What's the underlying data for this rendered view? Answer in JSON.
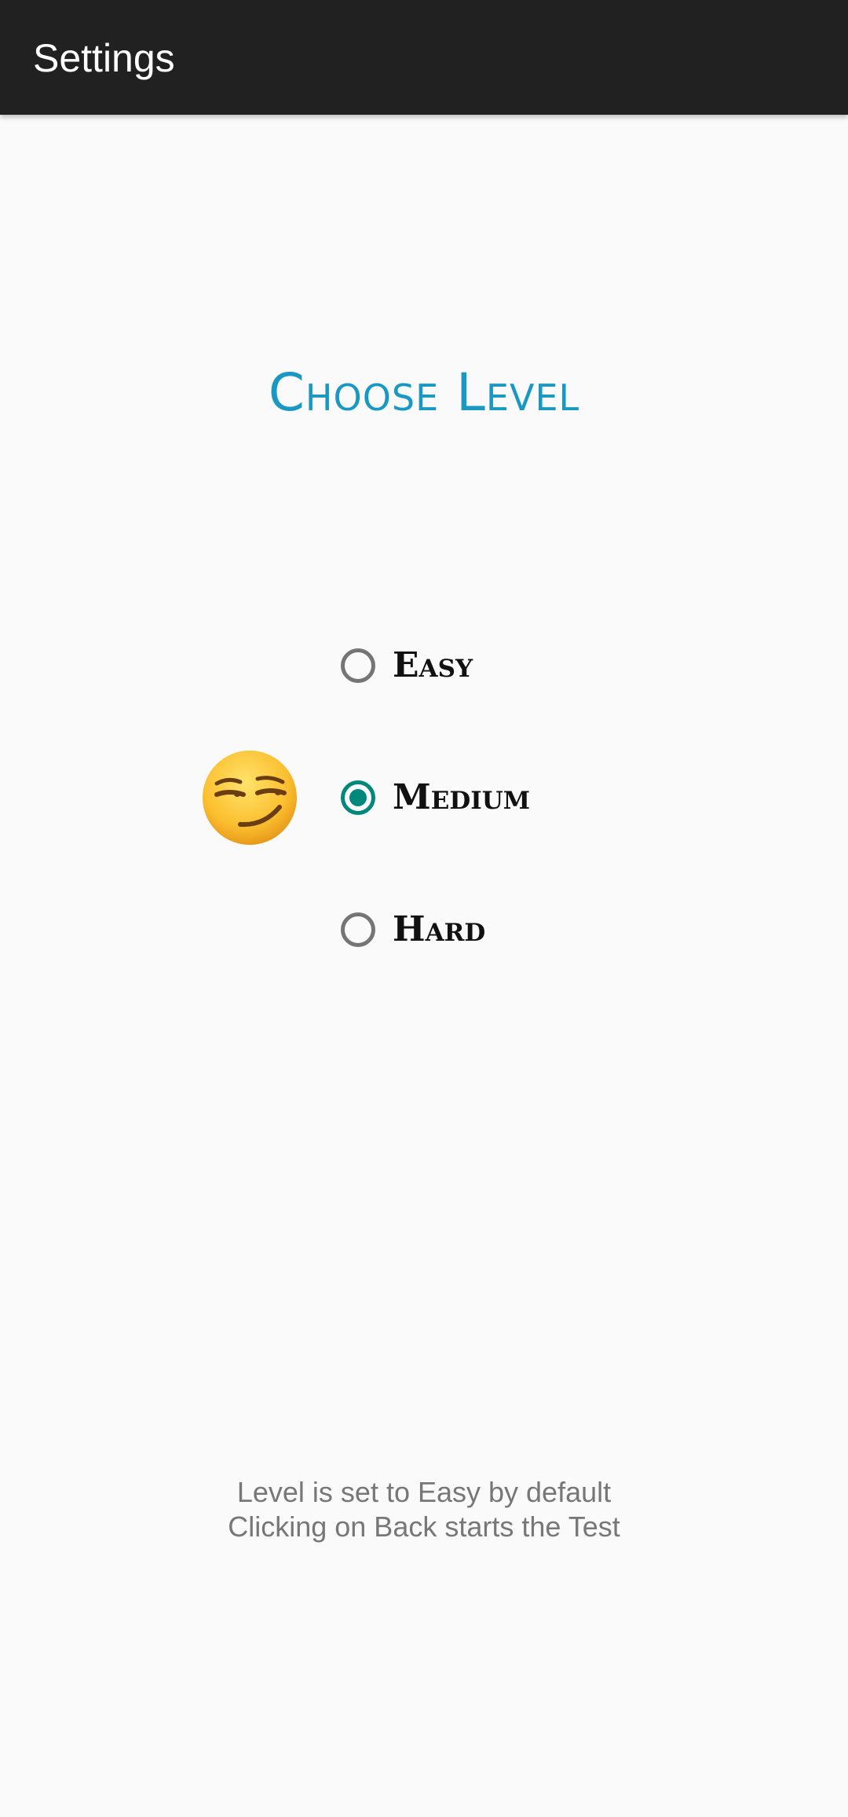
{
  "app_bar": {
    "title": "Settings"
  },
  "main": {
    "heading": "Choose Level",
    "mood_icon": "smirking-face-emoji",
    "options": [
      {
        "label": "Easy",
        "checked": false
      },
      {
        "label": "Medium",
        "checked": true
      },
      {
        "label": "Hard",
        "checked": false
      }
    ],
    "note_lines": [
      "Level is set to Easy by default",
      "Clicking on Back starts the Test"
    ]
  },
  "colors": {
    "app_bar": "#212121",
    "heading": "#1a98c4",
    "accent": "#00897b",
    "background": "#fafafa"
  }
}
